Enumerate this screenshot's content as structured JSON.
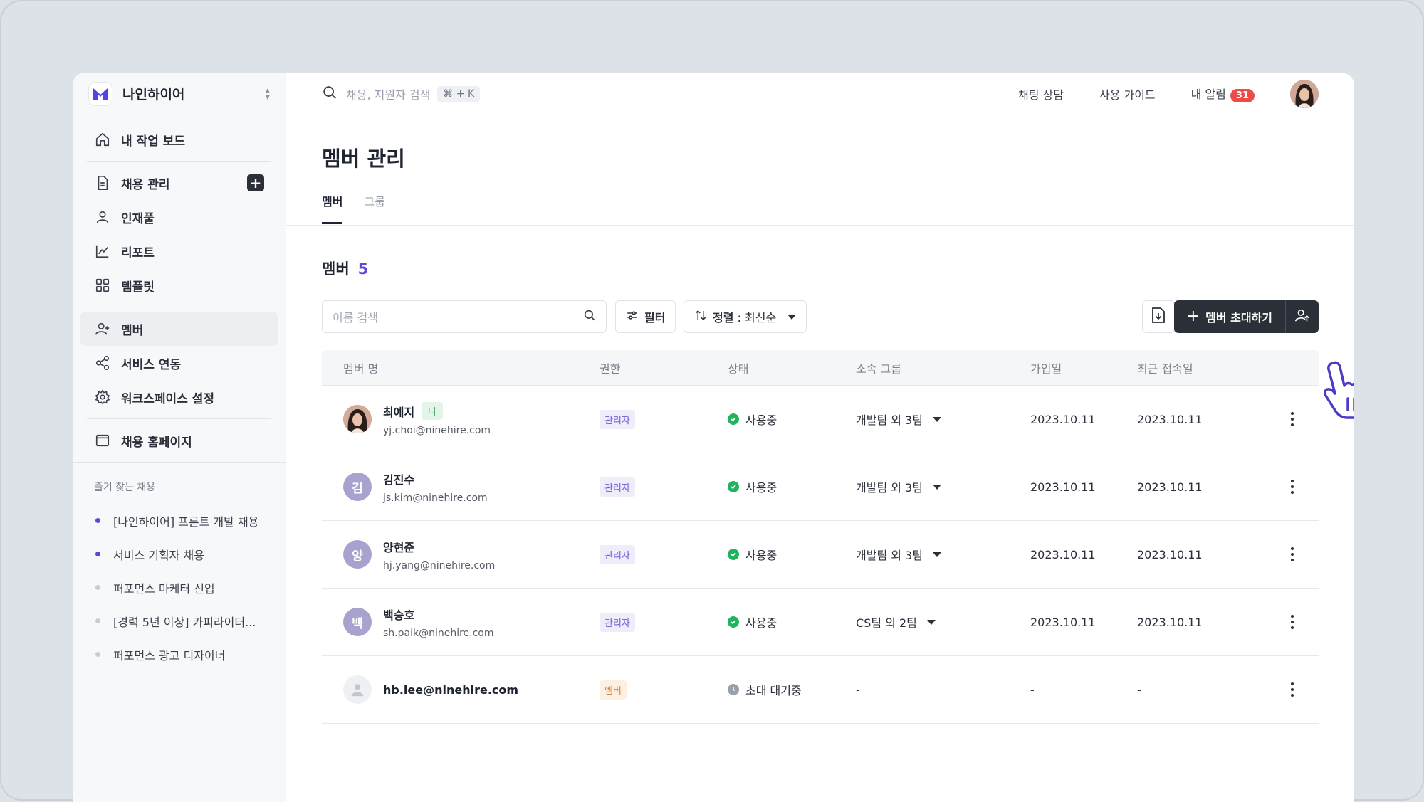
{
  "workspace": {
    "name": "나인하이어",
    "brand_color": "#4f46e5"
  },
  "sidebar": {
    "items": [
      {
        "label": "내 작업 보드",
        "icon": "home-icon"
      },
      {
        "label": "채용 관리",
        "icon": "document-icon"
      },
      {
        "label": "인재풀",
        "icon": "person-icon"
      },
      {
        "label": "리포트",
        "icon": "chart-line-icon"
      },
      {
        "label": "템플릿",
        "icon": "grid-icon"
      },
      {
        "label": "멤버",
        "icon": "user-plus-icon",
        "active": true
      },
      {
        "label": "서비스 연동",
        "icon": "share-icon"
      },
      {
        "label": "워크스페이스 설정",
        "icon": "gear-icon"
      },
      {
        "label": "채용 홈페이지",
        "icon": "window-icon"
      }
    ],
    "favorites_title": "즐겨 찾는 채용",
    "favorites": [
      {
        "label": "[나인하이어] 프론트 개발 채용",
        "dot_color": "#5b4ad6"
      },
      {
        "label": "서비스 기획자 채용",
        "dot_color": "#5b4ad6"
      },
      {
        "label": "퍼포먼스 마케터 신입",
        "dot_color": "#c8ccd3"
      },
      {
        "label": "[경력 5년 이상] 카피라이터...",
        "dot_color": "#c8ccd3"
      },
      {
        "label": "퍼포먼스 광고 디자이너",
        "dot_color": "#c8ccd3"
      }
    ]
  },
  "topbar": {
    "search_placeholder": "채용, 지원자 검색",
    "shortcut": "⌘ + K",
    "chat": "채팅 상담",
    "guide": "사용 가이드",
    "notifications": "내 알림",
    "notification_count": "31"
  },
  "main": {
    "title": "멤버 관리",
    "tabs": [
      {
        "label": "멤버",
        "active": true
      },
      {
        "label": "그룹",
        "active": false
      }
    ],
    "section_title": "멤버",
    "section_count": "5",
    "search_placeholder": "이름 검색",
    "filter_label": "필터",
    "sort_label": "정렬",
    "sort_value": " : 최신순",
    "invite_label": "멤버 초대하기"
  },
  "table": {
    "headers": [
      "멤버 명",
      "권한",
      "상태",
      "소속 그룹",
      "가입일",
      "최근 접속일"
    ],
    "rows": [
      {
        "name": "최예지",
        "me": "나",
        "email": "yj.choi@ninehire.com",
        "avatar": "",
        "avatar_type": "photo",
        "role": "관리자",
        "status": "사용중",
        "status_type": "active",
        "group": "개발팀 외 3팀",
        "joined": "2023.10.11",
        "last": "2023.10.11"
      },
      {
        "name": "김진수",
        "me": "",
        "email": "js.kim@ninehire.com",
        "avatar": "김",
        "avatar_type": "initial",
        "role": "관리자",
        "status": "사용중",
        "status_type": "active",
        "group": "개발팀 외 3팀",
        "joined": "2023.10.11",
        "last": "2023.10.11"
      },
      {
        "name": "양현준",
        "me": "",
        "email": "hj.yang@ninehire.com",
        "avatar": "양",
        "avatar_type": "initial",
        "role": "관리자",
        "status": "사용중",
        "status_type": "active",
        "group": "개발팀 외 3팀",
        "joined": "2023.10.11",
        "last": "2023.10.11"
      },
      {
        "name": "백승호",
        "me": "",
        "email": "sh.paik@ninehire.com",
        "avatar": "백",
        "avatar_type": "initial",
        "role": "관리자",
        "status": "사용중",
        "status_type": "active",
        "group": "CS팀 외 2팀",
        "joined": "2023.10.11",
        "last": "2023.10.11"
      },
      {
        "name": "hb.lee@ninehire.com",
        "me": "",
        "email": "",
        "avatar": "",
        "avatar_type": "placeholder",
        "role": "멤버",
        "status": "초대 대기중",
        "status_type": "pending",
        "group": "-",
        "joined": "-",
        "last": "-"
      }
    ]
  },
  "colors": {
    "primary_dark": "#2b2f37",
    "accent": "#5b4ad6",
    "status_active": "#22b35e",
    "status_pending": "#9aa0ab",
    "admin_badge_bg": "#f0edfb",
    "admin_badge_fg": "#6a5ad0",
    "member_badge_bg": "#fdf0e2",
    "member_badge_fg": "#d9822b"
  }
}
